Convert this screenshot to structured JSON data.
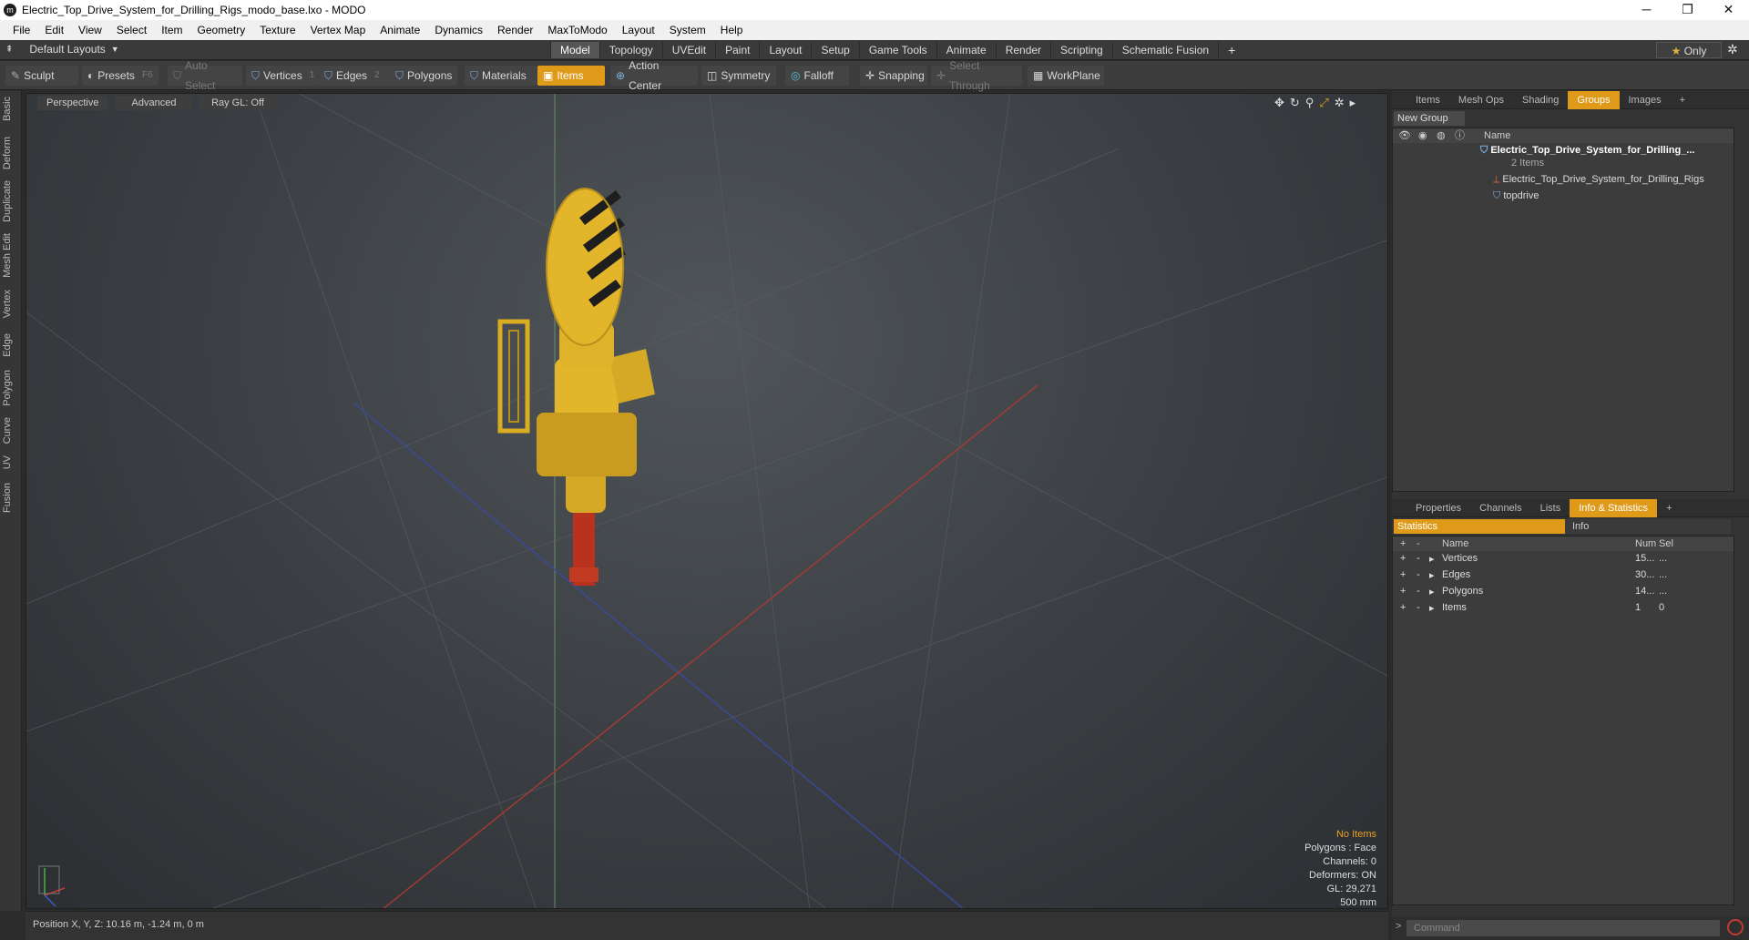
{
  "window": {
    "title": "Electric_Top_Drive_System_for_Drilling_Rigs_modo_base.lxo - MODO",
    "minimize": "─",
    "maximize": "❐",
    "close": "✕"
  },
  "menu": [
    "File",
    "Edit",
    "View",
    "Select",
    "Item",
    "Geometry",
    "Texture",
    "Vertex Map",
    "Animate",
    "Dynamics",
    "Render",
    "MaxToModo",
    "Layout",
    "System",
    "Help"
  ],
  "layout_bar": {
    "layouts_label": "Default Layouts",
    "tabs": [
      "Model",
      "Topology",
      "UVEdit",
      "Paint",
      "Layout",
      "Setup",
      "Game Tools",
      "Animate",
      "Render",
      "Scripting",
      "Schematic Fusion"
    ],
    "active_tab": "Model",
    "add": "+",
    "only_label": "Only"
  },
  "toolbar": {
    "sculpt": "Sculpt",
    "presets": "Presets",
    "presets_key": "F6",
    "auto_select": "Auto Select",
    "vertices": "Vertices",
    "vertices_key": "1",
    "edges": "Edges",
    "edges_key": "2",
    "polygons": "Polygons",
    "materials": "Materials",
    "items": "Items",
    "action_center": "Action Center",
    "symmetry": "Symmetry",
    "falloff": "Falloff",
    "snapping": "Snapping",
    "select_through": "Select Through",
    "workplane": "WorkPlane"
  },
  "left_tabs": [
    "Basic",
    "Deform",
    "Duplicate",
    "Mesh Edit",
    "Vertex",
    "Edge",
    "Polygon",
    "Curve",
    "UV",
    "Fusion"
  ],
  "viewport": {
    "perspective": "Perspective",
    "advanced": "Advanced",
    "raygl": "Ray GL: Off",
    "stats": {
      "no_items": "No Items",
      "polygons": "Polygons : Face",
      "channels": "Channels: 0",
      "deformers": "Deformers: ON",
      "gl": "GL: 29,271",
      "scale": "500 mm"
    }
  },
  "status": {
    "position": "Position X, Y, Z:  10.16 m, -1.24 m, 0 m"
  },
  "groups_panel": {
    "tabs": [
      "Items",
      "Mesh Ops",
      "Shading",
      "Groups",
      "Images"
    ],
    "active_tab": "Groups",
    "new_group": "New Group",
    "name_header": "Name",
    "root": "Electric_Top_Drive_System_for_Drilling_...",
    "root_count": "2 Items",
    "children": [
      "Electric_Top_Drive_System_for_Drilling_Rigs",
      "topdrive"
    ]
  },
  "info_panel": {
    "tabs": [
      "Properties",
      "Channels",
      "Lists",
      "Info & Statistics"
    ],
    "active_tab": "Info & Statistics",
    "subtabs": [
      "Statistics",
      "Info"
    ],
    "headers": {
      "name": "Name",
      "num": "Num",
      "sel": "Sel"
    },
    "rows": [
      {
        "name": "Vertices",
        "num": "15...",
        "sel": "..."
      },
      {
        "name": "Edges",
        "num": "30...",
        "sel": "..."
      },
      {
        "name": "Polygons",
        "num": "14...",
        "sel": "..."
      },
      {
        "name": "Items",
        "num": "1",
        "sel": "0"
      }
    ]
  },
  "command": {
    "placeholder": "Command"
  },
  "colors": {
    "accent": "#e09a1a",
    "model_yellow": "#e3b52a",
    "model_red": "#b8321e"
  }
}
